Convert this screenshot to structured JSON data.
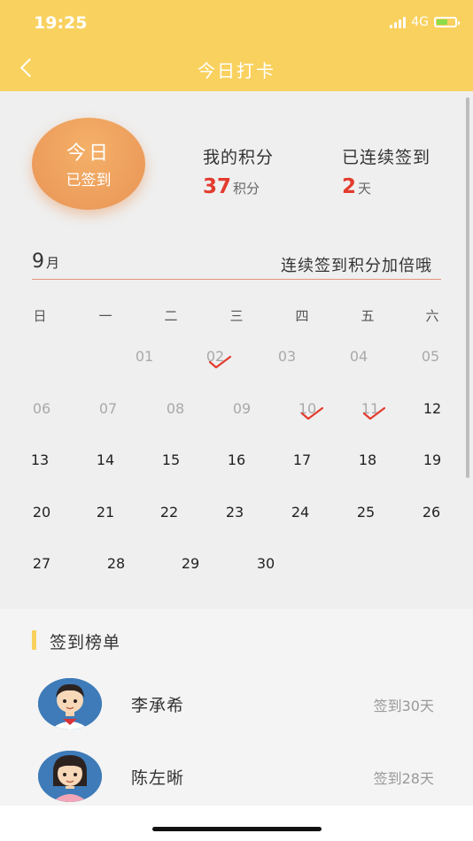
{
  "status_bar": {
    "time": "19:25",
    "network": "4G"
  },
  "header": {
    "title": "今日打卡"
  },
  "checkin_badge": {
    "line1": "今日",
    "line2": "已签到"
  },
  "stats": [
    {
      "label": "我的积分",
      "value": "37",
      "unit": "积分"
    },
    {
      "label": "已连续签到",
      "value": "2",
      "unit": "天"
    }
  ],
  "calendar": {
    "month": "9",
    "month_unit": "月",
    "tip": "连续签到积分加倍哦",
    "weekdays": [
      "日",
      "一",
      "二",
      "三",
      "四",
      "五",
      "六"
    ],
    "rows": [
      [
        {
          "d": "01",
          "state": "dim"
        },
        {
          "d": "02",
          "state": "dim",
          "checked": true
        },
        {
          "d": "03",
          "state": "dim"
        },
        {
          "d": "04",
          "state": "dim"
        },
        {
          "d": "05",
          "state": "dim"
        }
      ],
      [
        {
          "d": "06",
          "state": "dim"
        },
        {
          "d": "07",
          "state": "dim"
        },
        {
          "d": "08",
          "state": "dim"
        },
        {
          "d": "09",
          "state": "dim"
        },
        {
          "d": "10",
          "state": "dim",
          "checked": true
        },
        {
          "d": "11",
          "state": "dim",
          "checked": true
        },
        {
          "d": "12",
          "state": "cur"
        }
      ],
      [
        {
          "d": "13",
          "state": "cur"
        },
        {
          "d": "14",
          "state": "cur"
        },
        {
          "d": "15",
          "state": "cur"
        },
        {
          "d": "16",
          "state": "cur"
        },
        {
          "d": "17",
          "state": "cur"
        },
        {
          "d": "18",
          "state": "cur"
        },
        {
          "d": "19",
          "state": "cur"
        }
      ],
      [
        {
          "d": "20",
          "state": "cur"
        },
        {
          "d": "21",
          "state": "cur"
        },
        {
          "d": "22",
          "state": "cur"
        },
        {
          "d": "23",
          "state": "cur"
        },
        {
          "d": "24",
          "state": "cur"
        },
        {
          "d": "25",
          "state": "cur"
        },
        {
          "d": "26",
          "state": "cur"
        }
      ],
      [
        {
          "d": "27",
          "state": "cur"
        },
        {
          "d": "28",
          "state": "cur"
        },
        {
          "d": "29",
          "state": "cur"
        },
        {
          "d": "30",
          "state": "cur"
        }
      ]
    ]
  },
  "leaderboard": {
    "title": "签到榜单",
    "users": [
      {
        "name": "李承希",
        "days": "签到30天",
        "avatar": "boy"
      },
      {
        "name": "陈左晰",
        "days": "签到28天",
        "avatar": "girl"
      }
    ]
  },
  "colors": {
    "header": "#f9d15f",
    "accent_red": "#e33b2e",
    "badge": "#eea15e"
  }
}
